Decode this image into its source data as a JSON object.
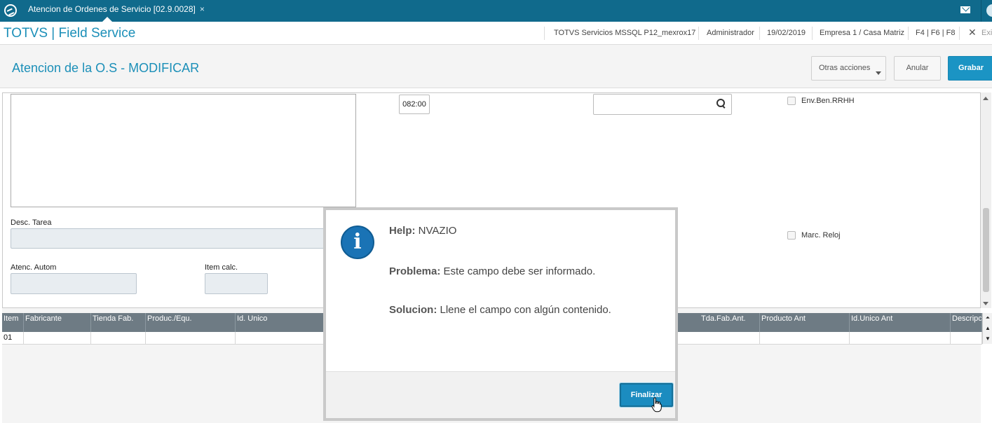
{
  "topbar": {
    "tab_title": "Atencion de Ordenes de Servicio [02.9.0028]",
    "tab_close": "×"
  },
  "header": {
    "brand": "TOTVS | Field Service",
    "environment": "TOTVS Servicios MSSQL P12_mexrox17",
    "user": "Administrador",
    "date": "19/02/2019",
    "company": "Empresa 1 / Casa Matriz",
    "shortcuts": "F4 | F6 | F8",
    "close": "✕",
    "exit": "Exi"
  },
  "titlebar": {
    "title": "Atencion de la O.S - MODIFICAR",
    "more_actions": "Otras acciones",
    "cancel": "Anular",
    "save": "Grabar"
  },
  "form": {
    "time_value": "082:00",
    "env_ben_label": "Env.Ben.RRHH",
    "marc_reloj_label": "Marc. Reloj",
    "desc_tarea_label": "Desc. Tarea",
    "atenc_autom_label": "Atenc. Autom",
    "item_calc_label": "Item calc."
  },
  "grid": {
    "columns": [
      "Item",
      "Fabricante",
      "Tienda Fab.",
      "Produc./Equ.",
      "Id. Unico",
      "Tda.Fab.Ant.",
      "Producto Ant",
      "Id.Unico Ant",
      "Descripcion"
    ],
    "rows": [
      [
        "01",
        "",
        "",
        "",
        "",
        "",
        "",
        "",
        ""
      ]
    ],
    "nav": [
      "⏶",
      "▲",
      "▼"
    ]
  },
  "dialog": {
    "help_label": "Help:",
    "help_value": "NVAZIO",
    "problem_label": "Problema:",
    "problem_value": "Este campo debe ser informado.",
    "solution_label": "Solucion:",
    "solution_value": "Llene el campo con algún contenido.",
    "finish_button": "Finalizar",
    "icon_glyph": "i"
  },
  "colors": {
    "topbar": "#106a8c",
    "accent": "#1b8fb8",
    "primary_button": "#1b94c4",
    "grid_header": "#6e7b84"
  }
}
